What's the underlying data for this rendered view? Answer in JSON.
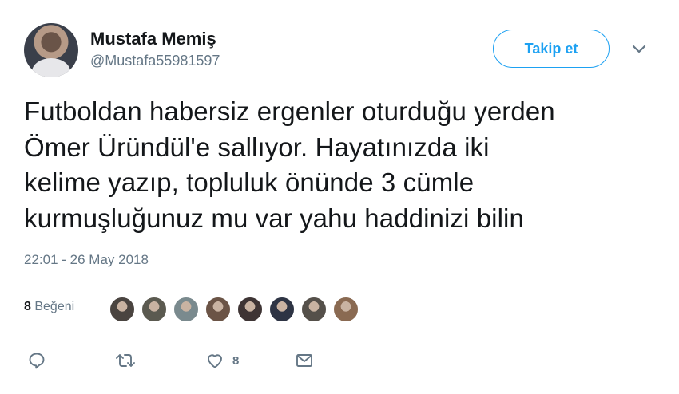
{
  "user": {
    "name": "Mustafa Memiş",
    "handle": "@Mustafa55981597"
  },
  "follow_label": "Takip et",
  "tweet": {
    "lines": [
      "Futboldan habersiz ergenler oturduğu yerden",
      "Ömer Üründül'e sallıyor. Hayatınızda iki",
      "kelime yazıp, topluluk önünde 3 cümle",
      "kurmuşluğunuz mu var yahu haddinizi bilin"
    ],
    "timestamp": "22:01 - 26 May 2018"
  },
  "likes": {
    "count": "8",
    "label": "Beğeni"
  },
  "actions": {
    "like_count": "8"
  },
  "colors": {
    "accent": "#1da1f2",
    "muted": "#657786",
    "text": "#14171a",
    "divider": "#e6ecf0",
    "likers": [
      "#4a4440",
      "#5b5a50",
      "#7a8a8e",
      "#6b5446",
      "#3e3434",
      "#2e3444",
      "#55504a",
      "#8a6a52"
    ]
  },
  "icons": [
    "chevron-down-icon",
    "reply-icon",
    "retweet-icon",
    "heart-icon",
    "envelope-icon"
  ]
}
